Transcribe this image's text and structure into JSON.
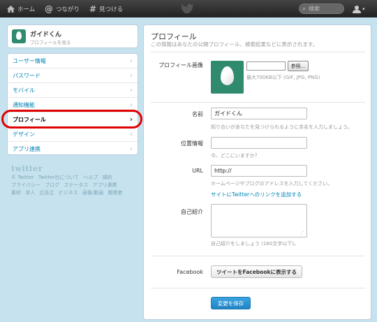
{
  "topbar": {
    "home_icon": "home-icon",
    "home_label": "ホーム",
    "connect_icon": "at-icon",
    "connect_label": "つながり",
    "discover_icon": "hash-icon",
    "discover_label": "見つける",
    "logo_icon": "twitter-bird-icon",
    "search_placeholder": "検索",
    "user_icon": "user-icon",
    "user_caret": "▾"
  },
  "profile_card": {
    "name": "ガイドくん",
    "sub": "プロフィールを見る"
  },
  "sidebar": {
    "items": [
      {
        "label": "ユーザー情報"
      },
      {
        "label": "パスワード"
      },
      {
        "label": "モバイル"
      },
      {
        "label": "通知機能"
      },
      {
        "label": "プロフィール"
      },
      {
        "label": "デザイン"
      },
      {
        "label": "アプリ連携"
      }
    ],
    "chevron": "›"
  },
  "footer": {
    "logo": "twitter",
    "line1": [
      "© Twitter",
      "Twitter社について",
      "ヘルプ",
      "規約"
    ],
    "line2": [
      "プライバシー",
      "ブログ",
      "ステータス",
      "アプリ連携"
    ],
    "line3": [
      "素材",
      "求人",
      "広告主",
      "ビジネス",
      "画像/動画",
      "開発者"
    ]
  },
  "main": {
    "title": "プロフィール",
    "subtitle": "この情報はあなたの公開プロフィール、検索結果などに表示されます。",
    "photo": {
      "label": "プロフィール画像",
      "browse": "参照...",
      "help": "最大700KB以下 (GIF, JPG, PNG)"
    },
    "name": {
      "label": "名前",
      "value": "ガイドくん",
      "help": "知り合いがあなたを見つけられるように本名を入力しましょう。"
    },
    "location": {
      "label": "位置情報",
      "value": "",
      "help": "今、どこにいますか？"
    },
    "url": {
      "label": "URL",
      "value": "http://",
      "help": "ホームページやブログのアドレスを入力してください。",
      "link": "サイトにTwitterへのリンクを追加する"
    },
    "bio": {
      "label": "自己紹介",
      "value": "",
      "help": "自己紹介をしましょう (160文字以下)。"
    },
    "facebook": {
      "label": "Facebook",
      "button": "ツイートをFacebookに表示する"
    },
    "save_button": "変更を保存"
  },
  "colors": {
    "background": "#c6e2ee",
    "link": "#0084b4",
    "save_button": "#2b91d2",
    "highlight": "#e00000",
    "egg_bg": "#2f8a6e"
  }
}
